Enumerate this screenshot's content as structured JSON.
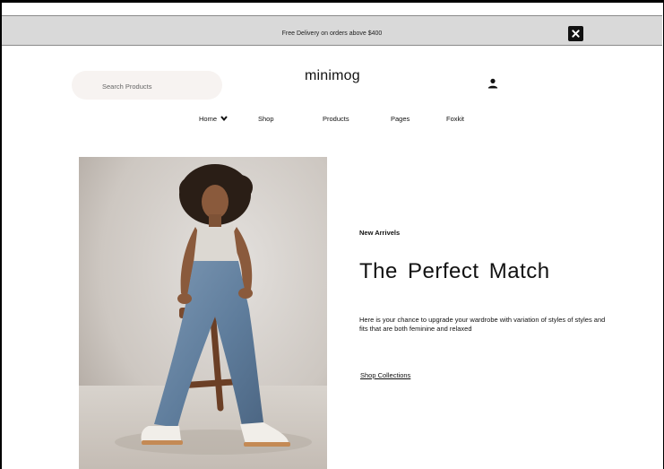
{
  "announcement": {
    "text": "Free Delivery on orders above $400",
    "close_icon": "close-icon"
  },
  "header": {
    "search_placeholder": "Search Products",
    "brand": "minimog",
    "account_icon": "user-icon"
  },
  "nav": {
    "items": [
      {
        "label": "Home",
        "has_dropdown": true
      },
      {
        "label": "Shop"
      },
      {
        "label": "Products"
      },
      {
        "label": "Pages"
      },
      {
        "label": "Foxkit"
      }
    ]
  },
  "hero": {
    "eyebrow": "New Arrivels",
    "headline": "The Perfect Match",
    "description": "Here is your chance to upgrade your wardrobe with variation of styles of styles and fits that are both feminine and relaxed",
    "cta": "Shop Collections"
  },
  "colors": {
    "announcement_bg": "#d9d9d9",
    "search_bg": "#f7f3f1",
    "text": "#111111"
  }
}
